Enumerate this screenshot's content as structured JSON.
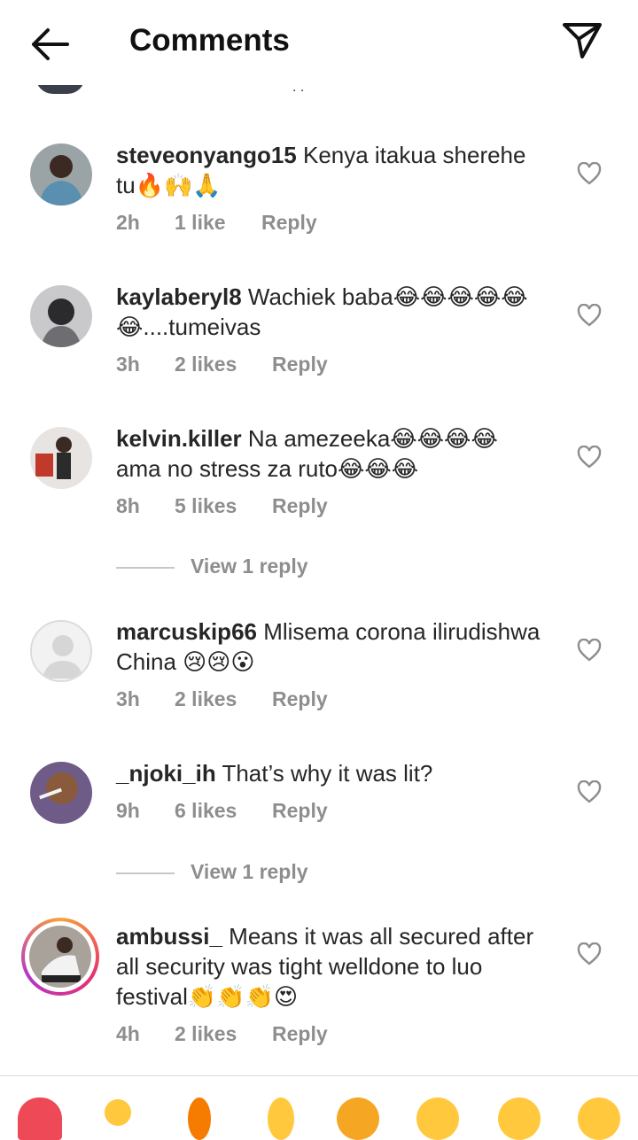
{
  "header": {
    "title": "Comments",
    "back_icon": "arrow-left-icon",
    "send_icon": "paper-plane-icon"
  },
  "partial_top": {
    "text": ". ."
  },
  "comments": [
    {
      "username": "steveonyango15",
      "text": " Kenya itakua sherehe tu🔥🙌🙏",
      "time": "2h",
      "likes": "1 like",
      "reply": "Reply"
    },
    {
      "username": "kaylaberyl8",
      "text": " Wachiek baba😂😂😂😂😂😂....tumeivas",
      "time": "3h",
      "likes": "2 likes",
      "reply": "Reply"
    },
    {
      "username": "kelvin.killer",
      "text": " Na amezeeka😂😂😂😂 ama no stress za ruto😂😂😂",
      "time": "8h",
      "likes": "5 likes",
      "reply": "Reply"
    },
    {
      "username": "marcuskip66",
      "text": " Mlisema corona ilirudishwa China 😢😢😮",
      "time": "3h",
      "likes": "2 likes",
      "reply": "Reply"
    },
    {
      "username": "_njoki_ih",
      "text": " That’s why it was lit?",
      "time": "9h",
      "likes": "6 likes",
      "reply": "Reply"
    },
    {
      "username": "ambussi_",
      "text": " Means it was all secured after all security was tight welldone to luo festival👏👏👏😍",
      "time": "4h",
      "likes": "2 likes",
      "reply": "Reply"
    }
  ],
  "view_replies": [
    "View 1 reply",
    "View 1 reply"
  ],
  "emoji_bar": {
    "items": [
      "red-heart",
      "raising-hands",
      "fire",
      "clapping-hands",
      "crying-face",
      "laughing-face",
      "smiling-face",
      "surprised-face"
    ]
  },
  "colors": {
    "text": "#262626",
    "meta": "#8e8e8e",
    "divider": "#dbdbdb",
    "heart_red": "#ed4956"
  }
}
